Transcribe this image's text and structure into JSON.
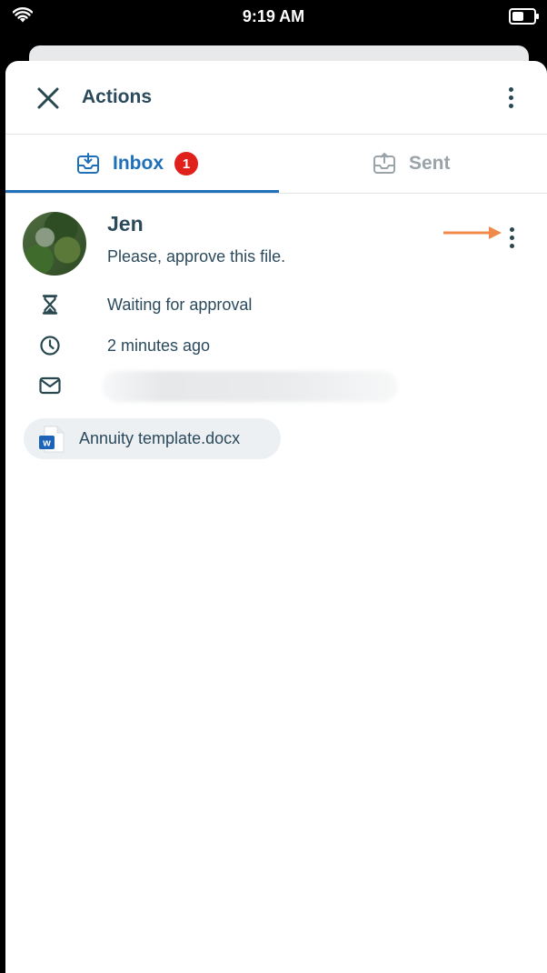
{
  "status_bar": {
    "time": "9:19 AM"
  },
  "header": {
    "title": "Actions"
  },
  "tabs": [
    {
      "label": "Inbox",
      "badge": "1",
      "active": true
    },
    {
      "label": "Sent",
      "active": false
    }
  ],
  "action_item": {
    "sender": "Jen",
    "message": "Please, approve this file.",
    "status": "Waiting for approval",
    "time_ago": "2 minutes ago",
    "attachment": "Annuity template.docx"
  },
  "colors": {
    "accent": "#1f6fb9",
    "badge": "#e0201b",
    "arrow": "#f0884a",
    "text": "#2b4a5c"
  },
  "icons": {
    "close": "close-icon",
    "more": "more-vertical-icon",
    "inbox": "inbox-tray-icon",
    "sent": "outbox-tray-icon",
    "status": "hourglass-icon",
    "time": "clock-icon",
    "email": "mail-icon",
    "attachment": "word-document-icon"
  }
}
